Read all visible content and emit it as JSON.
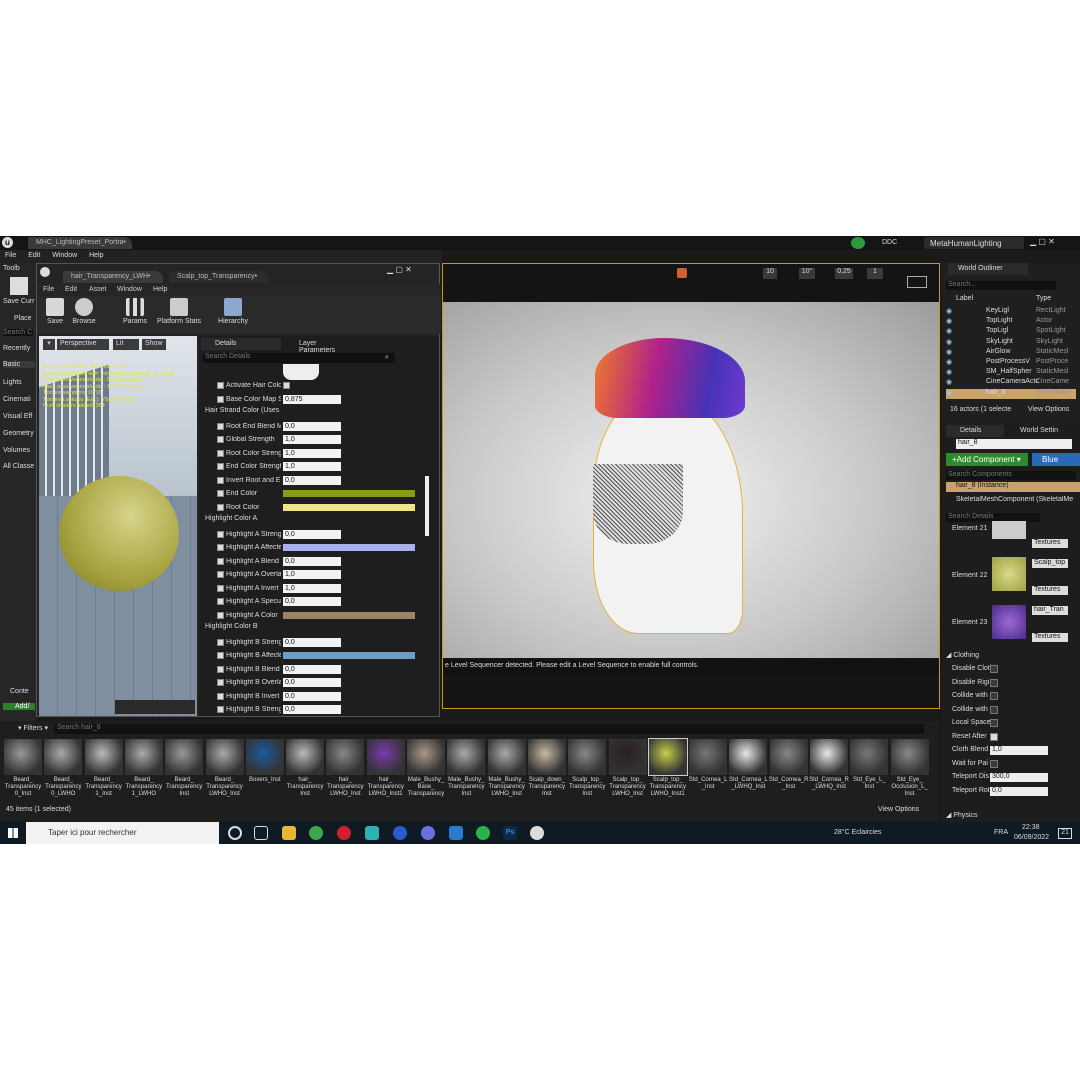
{
  "title_tab": "MHC_LightingPreset_Portra•",
  "app_title": "MetaHumanLighting",
  "ddc": "DDC",
  "main_menu": [
    "File",
    "Edit",
    "Window",
    "Help"
  ],
  "left": {
    "toolbar": "Toolb",
    "save": "Save Curr",
    "place": "Place",
    "search": "Search C",
    "items": [
      "Recently",
      "Basic",
      "Lights",
      "Cinemati",
      "Visual Eff",
      "Geometry",
      "Volumes",
      "All Classe"
    ],
    "content": "Conte",
    "add": "Add/"
  },
  "mat": {
    "tabs": [
      "hair_Transparency_LWH•",
      "Scalp_top_Transparency•"
    ],
    "menu": [
      "File",
      "Edit",
      "Asset",
      "Window",
      "Help"
    ],
    "buttons": [
      "Save",
      "Browse",
      "Params",
      "Platform Stats",
      "Hierarchy"
    ],
    "vp_buttons": [
      "Perspective",
      "Lit",
      "Show"
    ],
    "stats": [
      "Base pass shader: 391 instructions",
      "Base pass shader with Volumetric Lightmap: 581 instr",
      "Base pass vertex shader: 51 instructions",
      "Base pass vertex shader: 150 instructions",
      "Texture samplers: 10/16",
      "Texture Lookups (Est.): VS(0), PS(12)",
      "Num shaders added: 364"
    ],
    "panel_tabs": [
      "Details",
      "Layer Parameters"
    ],
    "search_placeholder": "Search Details",
    "rows": [
      {
        "label": "Activate Hair Color",
        "value": "cb"
      },
      {
        "label": "Base Color Map Str",
        "value": "0,875"
      },
      {
        "group": "Hair Strand Color (Uses"
      },
      {
        "label": "Root End Blend Mo",
        "value": "0,0"
      },
      {
        "label": "Global Strength",
        "value": "1,0"
      },
      {
        "label": "Root Color Strength",
        "value": "1,0"
      },
      {
        "label": "End Color Strength",
        "value": "1,0"
      },
      {
        "label": "Invert Root and End",
        "value": "0,0"
      },
      {
        "label": "End Color",
        "swatch": "#8a9a1a"
      },
      {
        "label": "Root Color",
        "swatch": "#f1e38a"
      },
      {
        "group": "Highlight Color A"
      },
      {
        "label": "Highlight A Strengt",
        "value": "0,0"
      },
      {
        "label": "Highlight A Affecte",
        "swatch": "#a9b0ea"
      },
      {
        "label": "Highlight A Blend M",
        "value": "0,0"
      },
      {
        "label": "Highlight A Overlap",
        "value": "1,0"
      },
      {
        "label": "Highlight A Invert E",
        "value": "1,0"
      },
      {
        "label": "Highlight A Specula",
        "value": "0,0"
      },
      {
        "label": "Highlight A Color",
        "swatch": "#9b8468"
      },
      {
        "group": "Highlight Color B"
      },
      {
        "label": "Highlight B Strengt",
        "value": "0,0"
      },
      {
        "label": "Highlight B Affecte",
        "swatch": "#6a9fc6"
      },
      {
        "label": "Highlight B Blend M",
        "value": "0,0"
      },
      {
        "label": "Highlight B Overlap",
        "value": "0,0"
      },
      {
        "label": "Highlight B Invert E",
        "value": "0,0"
      },
      {
        "label": "Highlight B Strengt",
        "value": "0,0"
      }
    ]
  },
  "viewport": {
    "message": "e Level Sequencer detected. Please edit a Level Sequence to enable full controls.",
    "values": [
      "10",
      "10°",
      "0,25",
      "1"
    ]
  },
  "outliner": {
    "title": "World Outliner",
    "search": "Search...",
    "col_label": "Label",
    "col_type": "Type",
    "rows": [
      {
        "l": "KeyLigl",
        "t": "RectLight"
      },
      {
        "l": "TopLight",
        "t": "Actor"
      },
      {
        "l": "TopLigl",
        "t": "SpotLight"
      },
      {
        "l": "SkyLight",
        "t": "SkyLight"
      },
      {
        "l": "AirGlow",
        "t": "StaticMesl"
      },
      {
        "l": "PostProcessV",
        "t": "PostProce"
      },
      {
        "l": "SM_HalfSpher",
        "t": "StaticMesl"
      },
      {
        "l": "CineCameraActc",
        "t": "CineCame"
      },
      {
        "l": "hair_8",
        "t": "SkeletalMe"
      }
    ],
    "footer": "16 actors (1 selecte",
    "view_options": "View Options"
  },
  "rdetails": {
    "tabs": [
      "Details",
      "World Settin"
    ],
    "name": "hair_8",
    "add": "Add Component",
    "bp": "Blue",
    "search_comp": "Search Components",
    "instance": "hair_8 (Instance)",
    "component": "SkeletalMeshComponent (SkeletalMe",
    "search_details": "Search Details",
    "elements": [
      {
        "n": "Element 21",
        "m": ""
      },
      {
        "n": "Element 22",
        "m": "Scalp_top"
      },
      {
        "n": "Element 23",
        "m": "hair_Tran"
      }
    ],
    "textures": "Textures",
    "clothing": "Clothing",
    "cloth_rows": [
      "Disable Cloth",
      "Disable Rigi",
      "Collide with",
      "Collide with",
      "Local Space",
      "Reset After",
      "Cloth Blend W",
      "Wait for Pai",
      "Teleport Dis",
      "Teleport Rot"
    ],
    "cloth_vals": [
      "1,0",
      "300,0",
      "0,0"
    ],
    "physics": "Physics"
  },
  "content": {
    "filters": "Filters",
    "search": "Search hair_8",
    "assets": [
      [
        "Beard_",
        "Transparency",
        "0_Inst"
      ],
      [
        "Beard_",
        "Transparency",
        "0_LWHO"
      ],
      [
        "Beard_",
        "Transparency",
        "1_Inst"
      ],
      [
        "Beard_",
        "Transparency",
        "1_LWHO"
      ],
      [
        "Beard_",
        "Transparency",
        "Inst"
      ],
      [
        "Beard_",
        "Transparency",
        "LWHO_Inst"
      ],
      [
        "Boxers_Inst"
      ],
      [
        "hair_",
        "Transparency",
        "Inst"
      ],
      [
        "hair_",
        "Transparency",
        "LWHO_Inst"
      ],
      [
        "hair_",
        "Transparency",
        "LWHO_Inst1"
      ],
      [
        "Male_Bushy_",
        "Base_",
        "Transparency"
      ],
      [
        "Male_Bushy_",
        "Transparency",
        "Inst"
      ],
      [
        "Male_Bushy_",
        "Transparency",
        "LWHO_Inst"
      ],
      [
        "Scalp_down_",
        "Transparency",
        "Inst"
      ],
      [
        "Scalp_top_",
        "Transparency",
        "Inst"
      ],
      [
        "Scalp_top_",
        "Transparency",
        "LWHO_Inst"
      ],
      [
        "Scalp_top_",
        "Transparency",
        "LWHO_Inst1"
      ],
      [
        "Std_Cornea_L",
        "_Inst"
      ],
      [
        "Std_Cornea_L",
        "_LWHQ_Inst"
      ],
      [
        "Std_Cornea_R",
        "_Inst"
      ],
      [
        "Std_Cornea_R",
        "_LWHQ_Inst"
      ],
      [
        "Std_Eye_L_",
        "Inst"
      ],
      [
        "Std_Eye_",
        "Occlusion_L_",
        "Inst"
      ]
    ],
    "footer": "45 items (1 selected)",
    "view_options": "View Options"
  },
  "taskbar": {
    "search": "Taper ici pour rechercher",
    "weather": "28°C  Eclaircies",
    "lang": "FRA",
    "time": "22:38",
    "date": "06/09/2022",
    "notif": "21"
  }
}
